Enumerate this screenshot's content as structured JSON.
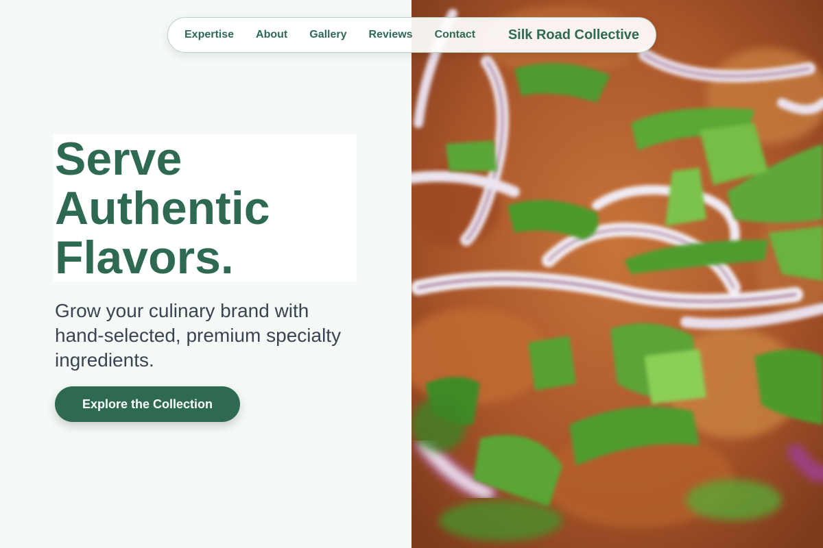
{
  "nav": {
    "links": [
      "Expertise",
      "About",
      "Gallery",
      "Reviews",
      "Contact"
    ],
    "brand": "Silk Road Collective"
  },
  "hero": {
    "headline_lines": [
      "Serve",
      "Authentic",
      "Flavors."
    ],
    "subtitle": "Grow your culinary brand with hand-selected, premium specialty ingredients.",
    "cta_label": "Explore the Collection"
  },
  "image": {
    "subject": "close-up of food topped with red onion and green onion"
  },
  "colors": {
    "accent": "#2e6a52",
    "background": "#f5faf7",
    "text": "#3a4452"
  }
}
